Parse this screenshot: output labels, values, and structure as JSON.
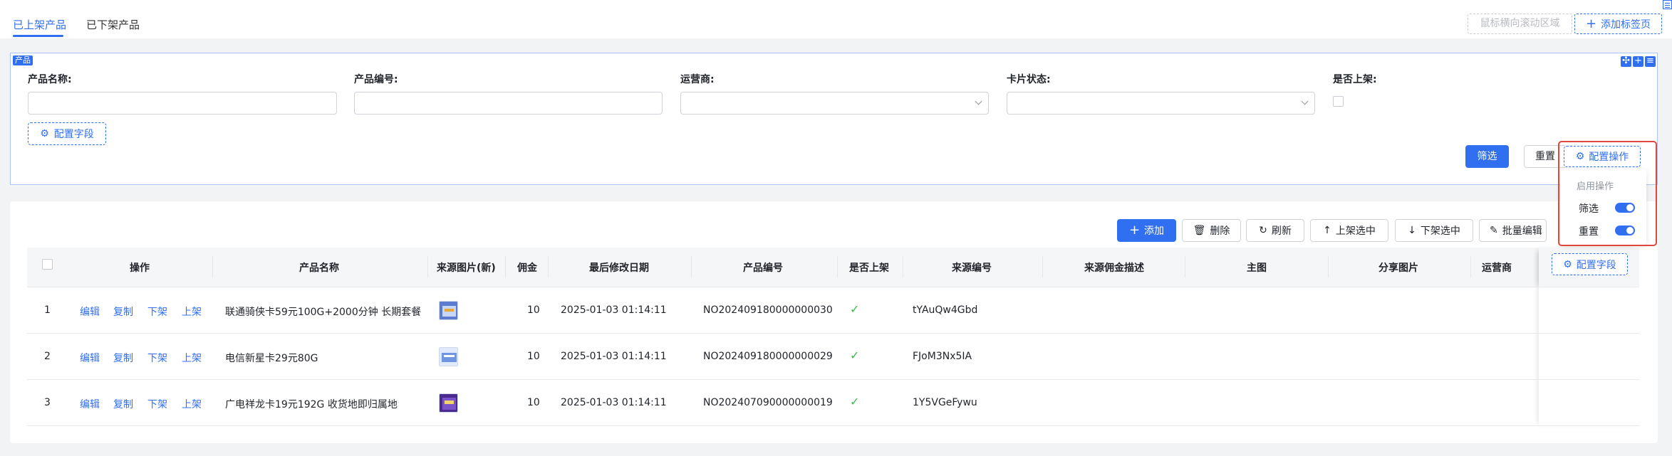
{
  "tabs": {
    "items": [
      {
        "label": "已上架产品",
        "active": true
      },
      {
        "label": "已下架产品",
        "active": false
      }
    ],
    "scroll_area_label": "鼠标横向滚动区域",
    "add_tab_label": "添加标签页"
  },
  "filter": {
    "panel_tag": "产品",
    "fields": [
      {
        "label": "产品名称:",
        "value": ""
      },
      {
        "label": "产品编号:",
        "value": ""
      },
      {
        "label": "运营商:",
        "value": ""
      },
      {
        "label": "卡片状态:",
        "value": ""
      },
      {
        "label": "是否上架:",
        "value": ""
      }
    ],
    "config_fields_label": "配置字段",
    "filter_label": "筛选",
    "reset_label": "重置",
    "config_ops_label": "配置操作",
    "popup": {
      "title": "启用操作",
      "options": [
        {
          "label": "筛选",
          "enabled": true
        },
        {
          "label": "重置",
          "enabled": true
        }
      ]
    }
  },
  "toolbar": {
    "add": "添加",
    "delete": "删除",
    "refresh": "刷新",
    "shelve_selected": "上架选中",
    "unshelve_selected": "下架选中",
    "batch_edit": "批量编辑"
  },
  "table": {
    "columns": [
      "操作",
      "产品名称",
      "来源图片(新)",
      "佣金",
      "最后修改日期",
      "产品编号",
      "是否上架",
      "来源编号",
      "来源佣金描述",
      "主图",
      "分享图片",
      "运营商"
    ],
    "config_columns_label": "配置字段",
    "row_actions": [
      "编辑",
      "复制",
      "下架",
      "上架"
    ],
    "rows": [
      {
        "index": "1",
        "name": "联通骑侠卡59元100G+2000分钟 长期套餐",
        "commission": "10",
        "modified": "2025-01-03 01:14:11",
        "code": "NO202409180000000030",
        "on_shelf": true,
        "source_code": "tYAuQw4Gbd"
      },
      {
        "index": "2",
        "name": "电信新星卡29元80G",
        "commission": "10",
        "modified": "2025-01-03 01:14:11",
        "code": "NO202409180000000029",
        "on_shelf": true,
        "source_code": "FJoM3Nx5IA"
      },
      {
        "index": "3",
        "name": "广电祥龙卡19元192G 收货地即归属地",
        "commission": "10",
        "modified": "2025-01-03 01:14:11",
        "code": "NO202407090000000019",
        "on_shelf": true,
        "source_code": "1Y5VGeFywu"
      }
    ]
  },
  "colors": {
    "primary": "#2f6ff0",
    "highlight_border": "#e0483c",
    "success": "#3fb950"
  }
}
